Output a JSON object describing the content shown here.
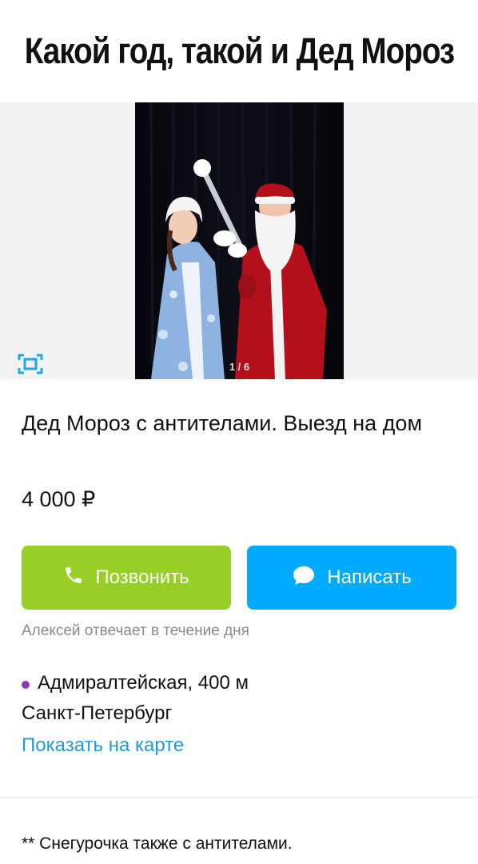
{
  "meme": {
    "title": "Какой год, такой и Дед Мороз"
  },
  "gallery": {
    "counter": "1 / 6",
    "icons": {
      "fullscreen": "fullscreen-icon"
    }
  },
  "listing": {
    "title": "Дед Мороз с антителами. Выезд на дом",
    "price": "4 000 ₽",
    "actions": {
      "call_label": "Позвонить",
      "write_label": "Написать",
      "call_color": "#97cf26",
      "write_color": "#00aaff",
      "icons": {
        "call": "phone-icon",
        "write": "chat-bubble-icon"
      }
    },
    "response_note": "Алексей отвечает в течение дня",
    "location": {
      "metro": "Адмиралтейская, 400 м",
      "metro_color": "#8e3cb3",
      "city": "Санкт-Петербург",
      "map_link": "Показать на карте"
    }
  },
  "footnote": "** Снегурочка также с антителами."
}
